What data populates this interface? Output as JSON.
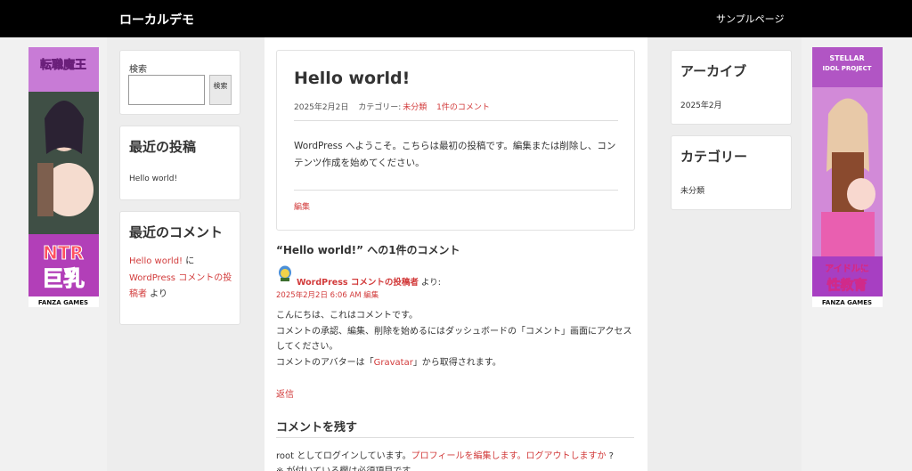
{
  "header": {
    "site_title": "ローカルデモ",
    "nav_sample_page": "サンプルページ"
  },
  "left_sidebar": {
    "search": {
      "label": "検索",
      "value": "",
      "button_label": "検索"
    },
    "recent_posts": {
      "title": "最近の投稿",
      "items": [
        "Hello world!"
      ]
    },
    "recent_comments": {
      "title": "最近のコメント",
      "author_link": "Hello world!",
      "connector": " に ",
      "post_link": "WordPress コメントの投稿者",
      "suffix": " より"
    }
  },
  "post": {
    "title": "Hello world!",
    "date": "2025年2月2日",
    "category_label": "カテゴリー:",
    "category": "未分類",
    "comment_count": "1件のコメント",
    "body": "WordPress へようこそ。こちらは最初の投稿です。編集または削除し、コンテンツ作成を始めてください。",
    "edit_label": "編集"
  },
  "comments": {
    "heading": "“Hello world!” への1件のコメント",
    "items": [
      {
        "author": "WordPress コメントの投稿者",
        "said": " より:",
        "date": "2025年2月2日 6:06 AM",
        "edit": "編集",
        "line1": "こんにちは、これはコメントです。",
        "line2": "コメントの承認、編集、削除を始めるにはダッシュボードの「コメント」画面にアクセスしてください。",
        "line3_pre": "コメントのアバターは「",
        "line3_link": "Gravatar",
        "line3_post": "」から取得されます。",
        "reply": "返信"
      }
    ]
  },
  "comment_form": {
    "title": "コメントを残す",
    "logged_in_pre": "root としてログインしています。",
    "edit_profile": "プロフィールを編集します。",
    "logout": "ログアウトしますか",
    "logged_in_post": " ?",
    "required_note": "※ が付いている欄は必須項目です"
  },
  "right_sidebar": {
    "archives": {
      "title": "アーカイブ",
      "items": [
        "2025年2月"
      ]
    },
    "categories": {
      "title": "カテゴリー",
      "items": [
        "未分類"
      ]
    }
  },
  "ads": {
    "left": {
      "top_text": "転職魔王",
      "big_text_1": "NTR",
      "big_text_2": "巨乳",
      "brand": "FANZA GAMES"
    },
    "right": {
      "top_text_1": "STELLAR",
      "top_text_2": "IDOL PROJECT",
      "big_text_1": "アイドルに",
      "big_text_2": "性教育",
      "brand": "FANZA GAMES"
    }
  },
  "colors": {
    "link": "#d23b3b",
    "header_bg": "#000000",
    "page_bg": "#f1f1f1"
  }
}
